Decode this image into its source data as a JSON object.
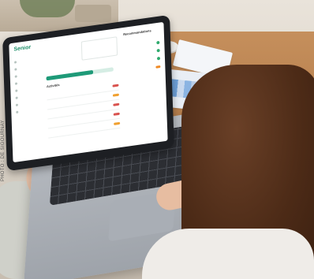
{
  "screen": {
    "logo_text": "Senior",
    "section_title": "Activités",
    "side_title": "Recommandations",
    "nav_count": 8,
    "progress_fraction": 0.7
  },
  "watermark": "PHOTO : DE SIGOURNAY",
  "colors": {
    "brand_green": "#1e9a78",
    "status_ok": "#2faa6d",
    "status_warn": "#f08a24",
    "status_alert": "#d9534f"
  }
}
